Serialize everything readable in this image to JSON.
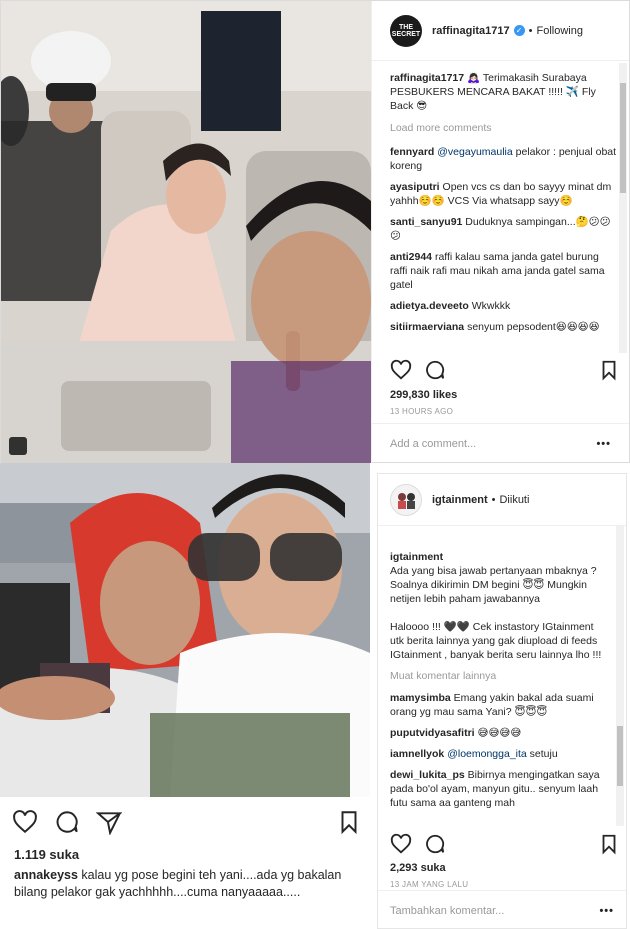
{
  "post1": {
    "header": {
      "username": "raffinagita1717",
      "follow_label": "Following",
      "avatar_label": "THE SECRET"
    },
    "caption": {
      "username": "raffinagita1717",
      "text": "🙇🏻‍♀️ Terimakasih Surabaya PESBUKERS MENCARA BAKAT !!!!! ✈️ Fly Back 😎"
    },
    "load_more_label": "Load more comments",
    "comments": [
      {
        "user": "fennyard",
        "mention": "@vegayumaulia",
        "text": " pelakor : penjual obat koreng"
      },
      {
        "user": "ayasiputri",
        "mention": "",
        "text": "Open vcs cs dan bo sayyy minat dm yahhh☺️☺️ VCS Via whatsapp sayy☺️"
      },
      {
        "user": "santi_sanyu91",
        "mention": "",
        "text": "Duduknya sampingan...🤔😕😕😕"
      },
      {
        "user": "anti2944",
        "mention": "",
        "text": "raffi kalau sama janda gatel burung raffi naik rafi mau nikah ama janda gatel sama gatel"
      },
      {
        "user": "adietya.deveeto",
        "mention": "",
        "text": "Wkwkkk"
      },
      {
        "user": "sitiirmaerviana",
        "mention": "",
        "text": "senyum pepsodent😆😆😆😆"
      }
    ],
    "likes": "299,830 likes",
    "time": "13 HOURS AGO",
    "add_comment_placeholder": "Add a comment...",
    "more_label": "•••"
  },
  "post2": {
    "left": {
      "likes": "1.119 suka",
      "caption_user": "annakeyss",
      "caption_text": "kalau yg pose begini teh yani....ada yg bakalan bilang pelakor gak yachhhhh....cuma nanyaaaaa....."
    },
    "header": {
      "username": "igtainment",
      "follow_label": "Diikuti"
    },
    "caption": {
      "username": "igtainment",
      "text": "Ada yang bisa jawab pertanyaan mbaknya ? Soalnya dikirimin DM begini 😇😇 Mungkin netijen lebih paham jawabannya\n\nHaloooo !!! 🖤🖤 Cek instastory IGtainment utk berita lainnya yang gak diupload di feeds IGtainment , banyak berita seru lainnya lho !!!"
    },
    "load_more_label": "Muat komentar lainnya",
    "comments": [
      {
        "user": "mamysimba",
        "mention": "",
        "text": "Emang yakin bakal ada suami orang yg mau sama Yani? 😇😇😇"
      },
      {
        "user": "puputvidyasafitri",
        "mention": "",
        "text": "😅😅😅😅"
      },
      {
        "user": "iamnellyok",
        "mention": "@loemongga_ita",
        "text": " setuju"
      },
      {
        "user": "dewi_lukita_ps",
        "mention": "",
        "text": "Bibirnya mengingatkan saya pada bo'ol ayam, manyun gitu.. senyum laah futu sama aa ganteng mah"
      }
    ],
    "likes": "2,293 suka",
    "time": "13 JAM YANG LALU",
    "add_comment_placeholder": "Tambahkan komentar...",
    "more_label": "•••"
  },
  "colors": {
    "text": "#262626",
    "muted": "#999999",
    "link": "#003569",
    "verified": "#3897f0",
    "border": "#dbdbdb"
  }
}
